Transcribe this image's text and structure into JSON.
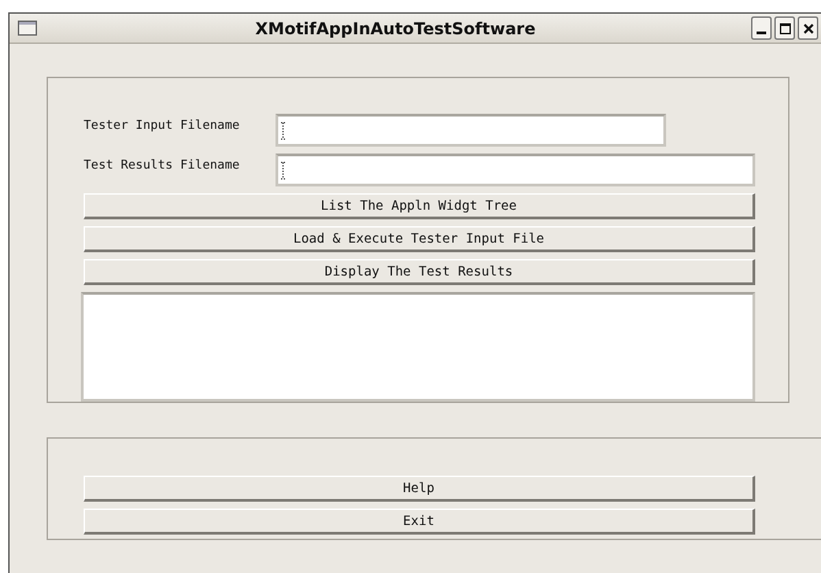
{
  "window": {
    "title": "XMotifAppInAutoTestSoftware"
  },
  "fields": [
    {
      "label": "Tester Input Filename"
    },
    {
      "label": "Test Results Filename"
    }
  ],
  "actions": [
    "List The Appln Widgt Tree",
    "Load & Execute Tester Input File",
    "Display The Test Results"
  ],
  "bottom_buttons": [
    "Help",
    "Exit"
  ]
}
